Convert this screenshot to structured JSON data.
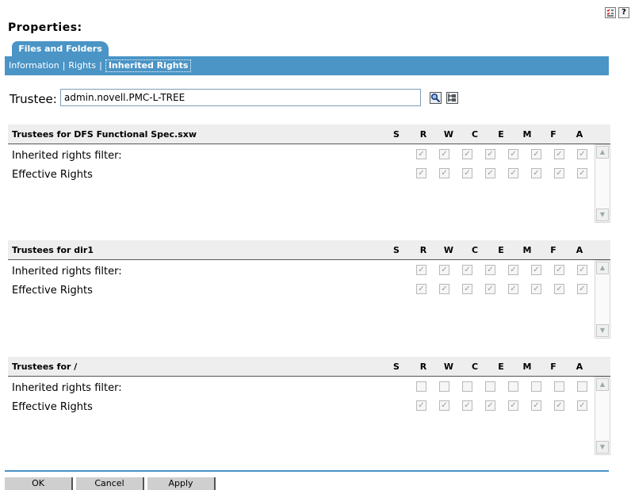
{
  "top_icons": [
    "checklist-icon",
    "help-icon"
  ],
  "help_label": "?",
  "page_title": "Properties:",
  "tab": {
    "label": "Files and Folders"
  },
  "subnav": {
    "items": [
      {
        "label": "Information",
        "active": false
      },
      {
        "label": "Rights",
        "active": false
      },
      {
        "label": "Inherited Rights",
        "active": true
      }
    ]
  },
  "trustee": {
    "label": "Trustee:",
    "value": "admin.novell.PMC-L-TREE",
    "icons": [
      "search-icon",
      "browse-tree-icon"
    ]
  },
  "columns": [
    "S",
    "R",
    "W",
    "C",
    "E",
    "M",
    "F",
    "A"
  ],
  "rights_columns": [
    "R",
    "W",
    "C",
    "E",
    "M",
    "F",
    "A"
  ],
  "sections": [
    {
      "title": "Trustees for DFS Functional Spec.sxw",
      "rows": [
        {
          "label": "Inherited rights filter:",
          "checked": [
            true,
            true,
            true,
            true,
            true,
            true,
            true,
            true
          ]
        },
        {
          "label": "Effective Rights",
          "checked": [
            true,
            true,
            true,
            true,
            true,
            true,
            true,
            true
          ]
        }
      ]
    },
    {
      "title": "Trustees for dir1",
      "rows": [
        {
          "label": "Inherited rights filter:",
          "checked": [
            true,
            true,
            true,
            true,
            true,
            true,
            true,
            true
          ]
        },
        {
          "label": "Effective Rights",
          "checked": [
            true,
            true,
            true,
            true,
            true,
            true,
            true,
            true
          ]
        }
      ]
    },
    {
      "title": "Trustees for /",
      "rows": [
        {
          "label": "Inherited rights filter:",
          "checked": [
            false,
            false,
            false,
            false,
            false,
            false,
            false,
            false
          ]
        },
        {
          "label": "Effective Rights",
          "checked": [
            true,
            true,
            true,
            true,
            true,
            true,
            true,
            true
          ]
        }
      ]
    }
  ],
  "buttons": [
    {
      "label": "OK"
    },
    {
      "label": "Cancel"
    },
    {
      "label": "Apply"
    }
  ],
  "colors": {
    "accent": "#4a94c6",
    "header_bg": "#eeeeee"
  }
}
